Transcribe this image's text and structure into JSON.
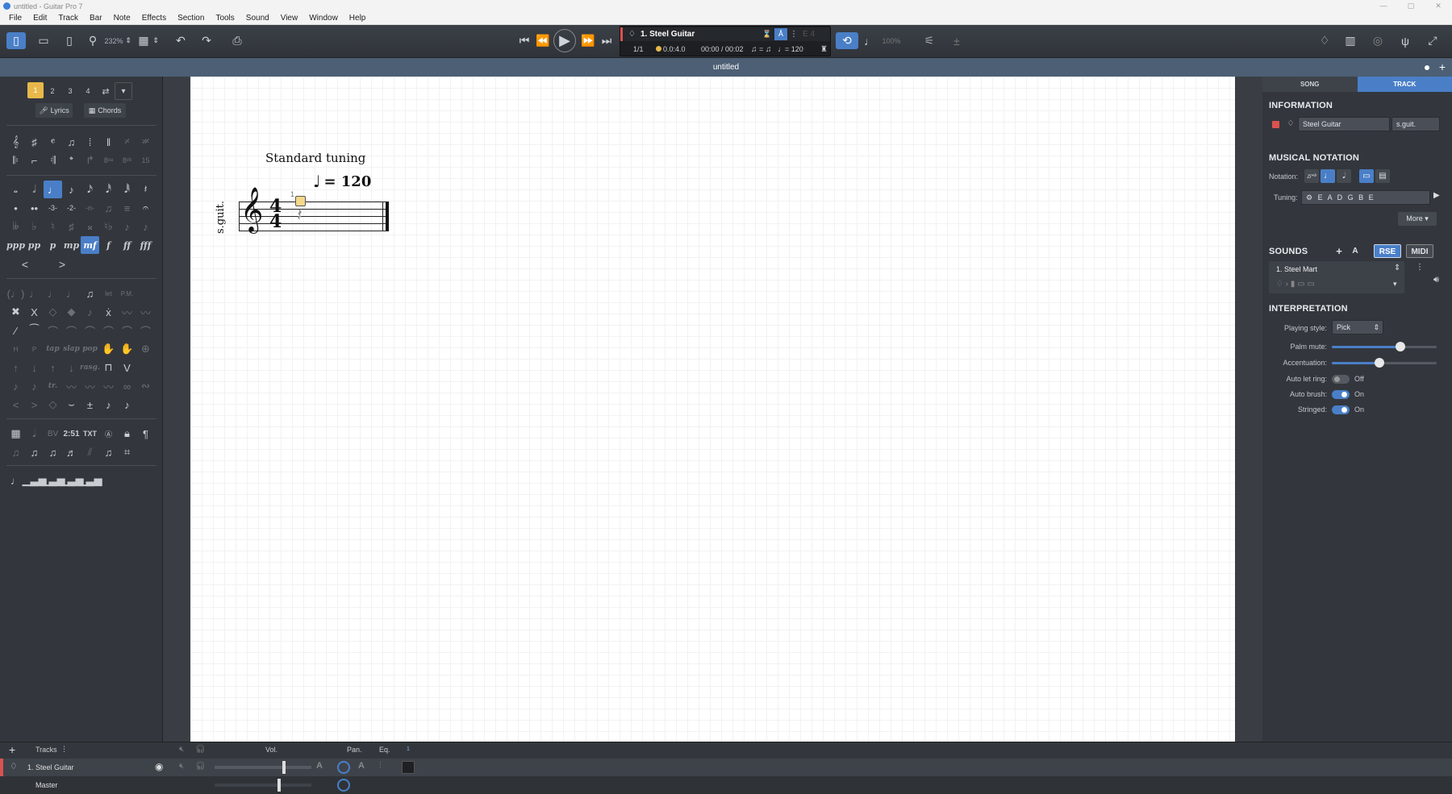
{
  "window": {
    "title": "untitled - Guitar Pro 7",
    "minimize": "—",
    "maximize": "▢",
    "close": "✕"
  },
  "menu": [
    "File",
    "Edit",
    "Track",
    "Bar",
    "Note",
    "Effects",
    "Section",
    "Tools",
    "Sound",
    "View",
    "Window",
    "Help"
  ],
  "toolbar": {
    "zoom": "232%"
  },
  "lcd": {
    "track": "1. Steel Guitar",
    "bar": "1/1",
    "pos": "0.0:4.0",
    "time": "00:00 / 00:02",
    "eq": "=",
    "tempo": "= 120",
    "key": "E 4",
    "speed": "100%"
  },
  "document": {
    "tab_title": "untitled"
  },
  "score": {
    "tuning": "Standard tuning",
    "tempo": "= 120",
    "instrument_short": "s.guit.",
    "bar_number": "1",
    "time_sig_top": "4",
    "time_sig_bottom": "4"
  },
  "left_panel": {
    "voices": [
      "1",
      "2",
      "3",
      "4"
    ],
    "lyrics": "Lyrics",
    "chords": "Chords",
    "dynamics": [
      "ppp",
      "pp",
      "p",
      "mp",
      "mf",
      "f",
      "ff",
      "fff"
    ]
  },
  "right_panel": {
    "tabs": [
      "SONG",
      "TRACK"
    ],
    "information": {
      "heading": "INFORMATION",
      "name": "Steel Guitar",
      "short": "s.guit."
    },
    "notation": {
      "heading": "MUSICAL NOTATION",
      "label": "Notation:",
      "tuning_label": "Tuning:",
      "tuning_value": "E A D G B E",
      "more": "More"
    },
    "sounds": {
      "heading": "SOUNDS",
      "add": "+",
      "a": "A",
      "rse": "RSE",
      "midi": "MIDI",
      "preset": "1. Steel Mart"
    },
    "interpretation": {
      "heading": "INTERPRETATION",
      "style_label": "Playing style:",
      "style_value": "Pick",
      "palm_label": "Palm mute:",
      "palm_value": 0.65,
      "accent_label": "Accentuation:",
      "accent_value": 0.45,
      "letring_label": "Auto let ring:",
      "letring_state": "Off",
      "brush_label": "Auto brush:",
      "brush_state": "On",
      "stringed_label": "Stringed:",
      "stringed_state": "On"
    }
  },
  "tracks": {
    "add": "+",
    "header": "Tracks",
    "vol": "Vol.",
    "pan": "Pan.",
    "eq": "Eq.",
    "eq_marker": "1",
    "track1": "1. Steel Guitar",
    "master": "Master"
  },
  "colors": {
    "accent": "#4a7fc8",
    "track_red": "#d9534f",
    "voice_active": "#e8b84a"
  }
}
